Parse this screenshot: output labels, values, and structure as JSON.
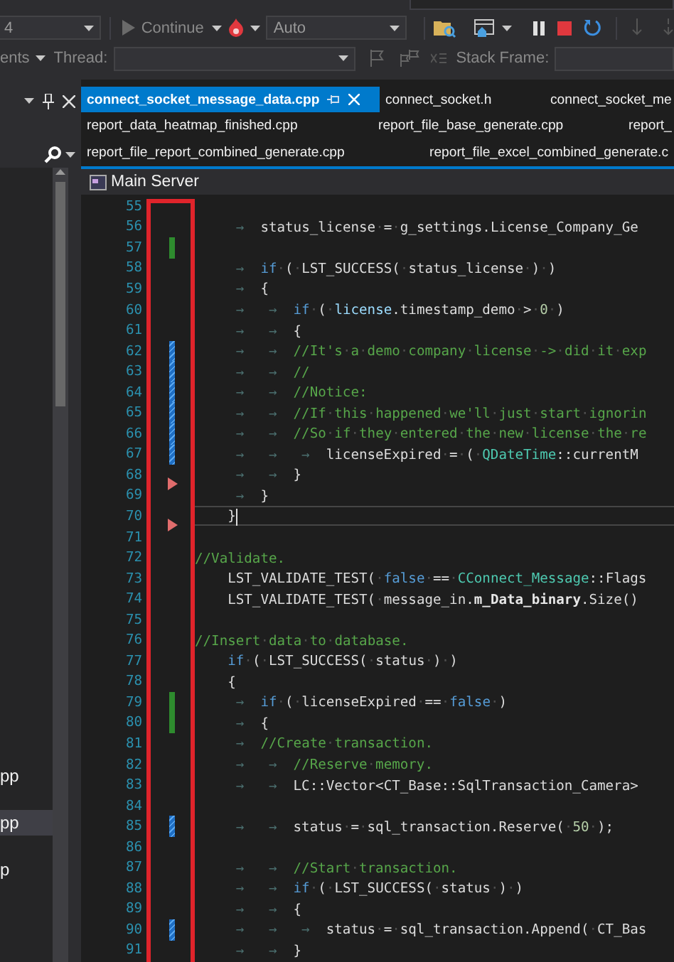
{
  "toolbar": {
    "config_dropdown": "4",
    "continue_button": "Continue",
    "mode_dropdown": "Auto",
    "events_label": "ents",
    "thread_label": "Thread:",
    "stack_frame_label": "Stack Frame:"
  },
  "left_panel": {
    "items": [
      {
        "label": "pp",
        "selected": false
      },
      {
        "label": "pp",
        "selected": true
      },
      {
        "label": "p",
        "selected": false
      }
    ]
  },
  "tab_rows": [
    {
      "tabs": [
        {
          "label": "connect_socket_message_data.cpp",
          "selected": true
        },
        {
          "label": "connect_socket.h",
          "selected": false
        },
        {
          "label": "connect_socket_me",
          "selected": false
        }
      ]
    },
    {
      "tabs": [
        {
          "label": "report_data_heatmap_finished.cpp",
          "selected": false
        },
        {
          "label": "report_file_base_generate.cpp",
          "selected": false
        },
        {
          "label": "report_",
          "selected": false
        }
      ]
    },
    {
      "tabs": [
        {
          "label": "report_file_report_combined_generate.cpp",
          "selected": false
        },
        {
          "label": "report_file_excel_combined_generate.c",
          "selected": false
        }
      ]
    }
  ],
  "editor": {
    "scope": "Main Server",
    "lines": [
      {
        "number": "55",
        "current": false
      },
      {
        "number": "56",
        "current": false,
        "tokens": [
          {
            "kind": "indent"
          },
          {
            "kind": "tab",
            "text": "→"
          },
          {
            "kind": "plain",
            "text": "status_license·=·g_settings.License_Company_Ge"
          }
        ]
      },
      {
        "number": "57",
        "current": false,
        "marker": {
          "kind": "added"
        }
      },
      {
        "number": "58",
        "current": false,
        "tokens": [
          {
            "kind": "indent"
          },
          {
            "kind": "tab",
            "text": "→"
          },
          {
            "kind": "keyword",
            "text": "if"
          },
          {
            "kind": "plain",
            "text": "·(·LST_SUCCESS(·status_license·)·)"
          }
        ]
      },
      {
        "number": "59",
        "current": false,
        "tokens": [
          {
            "kind": "indent"
          },
          {
            "kind": "tab",
            "text": "→"
          },
          {
            "kind": "plain",
            "text": "{"
          }
        ]
      },
      {
        "number": "60",
        "current": false,
        "tokens": [
          {
            "kind": "indent"
          },
          {
            "kind": "tab",
            "text": "→"
          },
          {
            "kind": "tab",
            "text": "→"
          },
          {
            "kind": "keyword",
            "text": "if"
          },
          {
            "kind": "plain",
            "text": "·(·"
          },
          {
            "kind": "variable",
            "text": "license"
          },
          {
            "kind": "plain",
            "text": ".timestamp_demo·>·"
          },
          {
            "kind": "number",
            "text": "0"
          },
          {
            "kind": "plain",
            "text": "·)"
          }
        ]
      },
      {
        "number": "61",
        "current": false,
        "tokens": [
          {
            "kind": "indent"
          },
          {
            "kind": "tab",
            "text": "→"
          },
          {
            "kind": "tab",
            "text": "→"
          },
          {
            "kind": "plain",
            "text": "{"
          }
        ]
      },
      {
        "number": "62",
        "current": false,
        "marker": {
          "kind": "modified"
        },
        "tokens": [
          {
            "kind": "indent"
          },
          {
            "kind": "tab",
            "text": "→"
          },
          {
            "kind": "tab",
            "text": "→"
          },
          {
            "kind": "comment",
            "text": "//It's·a·demo·company·license·->·did·it·exp"
          }
        ]
      },
      {
        "number": "63",
        "current": false,
        "marker": {
          "kind": "modified"
        },
        "tokens": [
          {
            "kind": "indent"
          },
          {
            "kind": "tab",
            "text": "→"
          },
          {
            "kind": "tab",
            "text": "→"
          },
          {
            "kind": "comment",
            "text": "//"
          }
        ]
      },
      {
        "number": "64",
        "current": false,
        "marker": {
          "kind": "modified"
        },
        "tokens": [
          {
            "kind": "indent"
          },
          {
            "kind": "tab",
            "text": "→"
          },
          {
            "kind": "tab",
            "text": "→"
          },
          {
            "kind": "comment",
            "text": "//Notice:"
          }
        ]
      },
      {
        "number": "65",
        "current": false,
        "marker": {
          "kind": "modified"
        },
        "tokens": [
          {
            "kind": "indent"
          },
          {
            "kind": "tab",
            "text": "→"
          },
          {
            "kind": "tab",
            "text": "→"
          },
          {
            "kind": "comment",
            "text": "//If·this·happened·we'll·just·start·ignorin"
          }
        ]
      },
      {
        "number": "66",
        "current": false,
        "marker": {
          "kind": "modified"
        },
        "tokens": [
          {
            "kind": "indent"
          },
          {
            "kind": "tab",
            "text": "→"
          },
          {
            "kind": "tab",
            "text": "→"
          },
          {
            "kind": "comment",
            "text": "//So·if·they·entered·the·new·license·the·re"
          }
        ]
      },
      {
        "number": "67",
        "current": false,
        "marker": {
          "kind": "modified"
        },
        "tokens": [
          {
            "kind": "indent"
          },
          {
            "kind": "tab",
            "text": "→"
          },
          {
            "kind": "tab",
            "text": "→"
          },
          {
            "kind": "tab",
            "text": "→"
          },
          {
            "kind": "plain",
            "text": "licenseExpired·=·(·"
          },
          {
            "kind": "type",
            "text": "QDateTime"
          },
          {
            "kind": "plain",
            "text": "::currentM"
          }
        ]
      },
      {
        "number": "68",
        "current": false,
        "marker": {
          "kind": "arrow"
        },
        "tokens": [
          {
            "kind": "indent"
          },
          {
            "kind": "tab",
            "text": "→"
          },
          {
            "kind": "tab",
            "text": "→"
          },
          {
            "kind": "plain",
            "text": "}"
          }
        ]
      },
      {
        "number": "69",
        "current": false,
        "tokens": [
          {
            "kind": "indent"
          },
          {
            "kind": "tab",
            "text": "→"
          },
          {
            "kind": "plain",
            "text": "}"
          }
        ]
      },
      {
        "number": "70",
        "current": true,
        "marker": {
          "kind": "arrow"
        },
        "tokens": [
          {
            "kind": "indent"
          },
          {
            "kind": "plain",
            "text": "}"
          }
        ]
      },
      {
        "number": "71",
        "current": false
      },
      {
        "number": "72",
        "current": false,
        "tokens": [
          {
            "kind": "comment",
            "text": "//Validate."
          }
        ]
      },
      {
        "number": "73",
        "current": false,
        "tokens": [
          {
            "kind": "indent"
          },
          {
            "kind": "plain",
            "text": "LST_VALIDATE_TEST(·"
          },
          {
            "kind": "keyword",
            "text": "false"
          },
          {
            "kind": "plain",
            "text": "·==·"
          },
          {
            "kind": "type",
            "text": "CConnect_Message"
          },
          {
            "kind": "plain",
            "text": "::Flags"
          }
        ]
      },
      {
        "number": "74",
        "current": false,
        "tokens": [
          {
            "kind": "indent"
          },
          {
            "kind": "plain",
            "text": "LST_VALIDATE_TEST(·message_in."
          },
          {
            "kind": "member",
            "text": "m_Data_binary"
          },
          {
            "kind": "plain",
            "text": ".Size()"
          }
        ]
      },
      {
        "number": "75",
        "current": false
      },
      {
        "number": "76",
        "current": false,
        "tokens": [
          {
            "kind": "comment",
            "text": "//Insert·data·to·database."
          }
        ]
      },
      {
        "number": "77",
        "current": false,
        "tokens": [
          {
            "kind": "indent"
          },
          {
            "kind": "keyword",
            "text": "if"
          },
          {
            "kind": "plain",
            "text": "·(·LST_SUCCESS(·status·)·)"
          }
        ]
      },
      {
        "number": "78",
        "current": false,
        "tokens": [
          {
            "kind": "indent"
          },
          {
            "kind": "plain",
            "text": "{"
          }
        ]
      },
      {
        "number": "79",
        "current": false,
        "marker": {
          "kind": "added"
        },
        "tokens": [
          {
            "kind": "indent"
          },
          {
            "kind": "tab",
            "text": "→"
          },
          {
            "kind": "keyword",
            "text": "if"
          },
          {
            "kind": "plain",
            "text": "·(·licenseExpired·==·"
          },
          {
            "kind": "keyword",
            "text": "false"
          },
          {
            "kind": "plain",
            "text": "·)"
          }
        ]
      },
      {
        "number": "80",
        "current": false,
        "marker": {
          "kind": "added"
        },
        "tokens": [
          {
            "kind": "indent"
          },
          {
            "kind": "tab",
            "text": "→"
          },
          {
            "kind": "plain",
            "text": "{"
          }
        ]
      },
      {
        "number": "81",
        "current": false,
        "tokens": [
          {
            "kind": "indent"
          },
          {
            "kind": "tab",
            "text": "→"
          },
          {
            "kind": "comment",
            "text": "//Create·transaction."
          }
        ]
      },
      {
        "number": "82",
        "current": false,
        "tokens": [
          {
            "kind": "indent"
          },
          {
            "kind": "tab",
            "text": "→"
          },
          {
            "kind": "tab",
            "text": "→"
          },
          {
            "kind": "comment",
            "text": "//Reserve·memory."
          }
        ]
      },
      {
        "number": "83",
        "current": false,
        "tokens": [
          {
            "kind": "indent"
          },
          {
            "kind": "tab",
            "text": "→"
          },
          {
            "kind": "tab",
            "text": "→"
          },
          {
            "kind": "plain",
            "text": "LC::Vector<CT_Base::SqlTransaction_Camera>"
          }
        ]
      },
      {
        "number": "84",
        "current": false
      },
      {
        "number": "85",
        "current": false,
        "marker": {
          "kind": "modified"
        },
        "tokens": [
          {
            "kind": "indent"
          },
          {
            "kind": "tab",
            "text": "→"
          },
          {
            "kind": "tab",
            "text": "→"
          },
          {
            "kind": "plain",
            "text": "status·=·sql_transaction.Reserve(·"
          },
          {
            "kind": "number",
            "text": "50"
          },
          {
            "kind": "plain",
            "text": "·);"
          }
        ]
      },
      {
        "number": "86",
        "current": false
      },
      {
        "number": "87",
        "current": false,
        "tokens": [
          {
            "kind": "indent"
          },
          {
            "kind": "tab",
            "text": "→"
          },
          {
            "kind": "tab",
            "text": "→"
          },
          {
            "kind": "comment",
            "text": "//Start·transaction."
          }
        ]
      },
      {
        "number": "88",
        "current": false,
        "tokens": [
          {
            "kind": "indent"
          },
          {
            "kind": "tab",
            "text": "→"
          },
          {
            "kind": "tab",
            "text": "→"
          },
          {
            "kind": "keyword",
            "text": "if"
          },
          {
            "kind": "plain",
            "text": "·(·LST_SUCCESS(·status·)·)"
          }
        ]
      },
      {
        "number": "89",
        "current": false,
        "tokens": [
          {
            "kind": "indent"
          },
          {
            "kind": "tab",
            "text": "→"
          },
          {
            "kind": "tab",
            "text": "→"
          },
          {
            "kind": "plain",
            "text": "{"
          }
        ]
      },
      {
        "number": "90",
        "current": false,
        "marker": {
          "kind": "modified"
        },
        "tokens": [
          {
            "kind": "indent"
          },
          {
            "kind": "tab",
            "text": "→"
          },
          {
            "kind": "tab",
            "text": "→"
          },
          {
            "kind": "tab",
            "text": "→"
          },
          {
            "kind": "plain",
            "text": "status·=·sql_transaction.Append(·CT_Bas"
          }
        ]
      },
      {
        "number": "91",
        "current": false,
        "tokens": [
          {
            "kind": "indent"
          },
          {
            "kind": "tab",
            "text": "→"
          },
          {
            "kind": "tab",
            "text": "→"
          },
          {
            "kind": "plain",
            "text": "}"
          }
        ]
      }
    ]
  }
}
